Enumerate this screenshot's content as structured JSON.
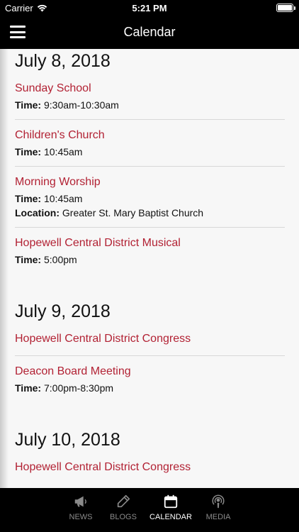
{
  "status": {
    "carrier": "Carrier",
    "time": "5:21 PM"
  },
  "nav": {
    "title": "Calendar"
  },
  "days": [
    {
      "date": "July 8, 2018",
      "events": [
        {
          "title": "Sunday School",
          "time_label": "Time:",
          "time": "9:30am-10:30am"
        },
        {
          "title": "Children's Church",
          "time_label": "Time:",
          "time": "10:45am"
        },
        {
          "title": "Morning Worship",
          "time_label": "Time:",
          "time": "10:45am",
          "location_label": "Location:",
          "location": "Greater St. Mary Baptist Church"
        },
        {
          "title": "Hopewell Central District Musical",
          "time_label": "Time:",
          "time": "5:00pm"
        }
      ]
    },
    {
      "date": "July 9, 2018",
      "events": [
        {
          "title": "Hopewell Central District Congress"
        },
        {
          "title": "Deacon Board Meeting",
          "time_label": "Time:",
          "time": "7:00pm-8:30pm"
        }
      ]
    },
    {
      "date": "July 10, 2018",
      "events": [
        {
          "title": "Hopewell Central District Congress"
        }
      ]
    }
  ],
  "tabs": [
    {
      "label": "NEWS",
      "icon": "megaphone-icon",
      "active": false
    },
    {
      "label": "BLOGS",
      "icon": "pencil-icon",
      "active": false
    },
    {
      "label": "CALENDAR",
      "icon": "calendar-icon",
      "active": true
    },
    {
      "label": "MEDIA",
      "icon": "podcast-icon",
      "active": false
    }
  ],
  "colors": {
    "accent": "#b22234",
    "bar": "#000000",
    "background": "#f7f7f7"
  }
}
